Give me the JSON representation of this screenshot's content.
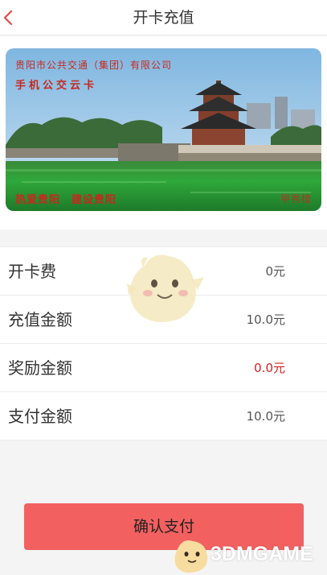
{
  "header": {
    "title": "开卡充值",
    "back_icon": "chevron-left-icon"
  },
  "card": {
    "company": "贵阳市公共交通（集团）有限公司",
    "name": "手机公交云卡",
    "slogan": "热爱贵阳　建设贵阳",
    "stamp": "甲秀楼"
  },
  "rows": [
    {
      "label": "开卡费",
      "value": "0元"
    },
    {
      "label": "充值金额",
      "value": "10.0元"
    },
    {
      "label": "奖励金额",
      "value": "0.0元"
    },
    {
      "label": "支付金额",
      "value": "10.0元"
    }
  ],
  "pay_button": {
    "label": "确认支付"
  },
  "watermark": {
    "text": "3DMGAME"
  },
  "colors": {
    "accent": "#f36060",
    "reward_value": "#d32020",
    "card_text": "#c8281e",
    "header_icon": "#e84848"
  }
}
